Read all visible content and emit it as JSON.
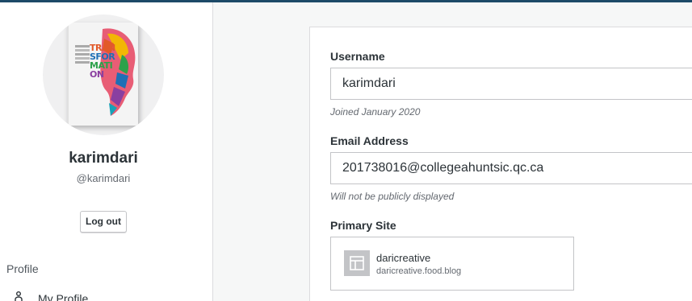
{
  "colors": {
    "topbar": "#1d4a68",
    "sidebar_bg": "#ffffff",
    "page_bg": "#f6f7f7"
  },
  "profile": {
    "avatar_book_cover": {
      "lines": [
        "TRAN",
        "SFOR",
        "MATI",
        "ON"
      ]
    },
    "display_name": "karimdari",
    "handle": "@karimdari",
    "logout_label": "Log out"
  },
  "nav": {
    "heading": "Profile",
    "items": [
      {
        "label": "My Profile",
        "icon": "person-icon"
      }
    ]
  },
  "form": {
    "username": {
      "label": "Username",
      "value": "karimdari",
      "hint": "Joined January 2020"
    },
    "email": {
      "label": "Email Address",
      "value": "201738016@collegeahuntsic.qc.ca",
      "hint": "Will not be publicly displayed"
    },
    "primary_site": {
      "label": "Primary Site",
      "site_name": "daricreative",
      "site_url": "daricreative.food.blog",
      "icon": "site-layout-icon"
    }
  }
}
